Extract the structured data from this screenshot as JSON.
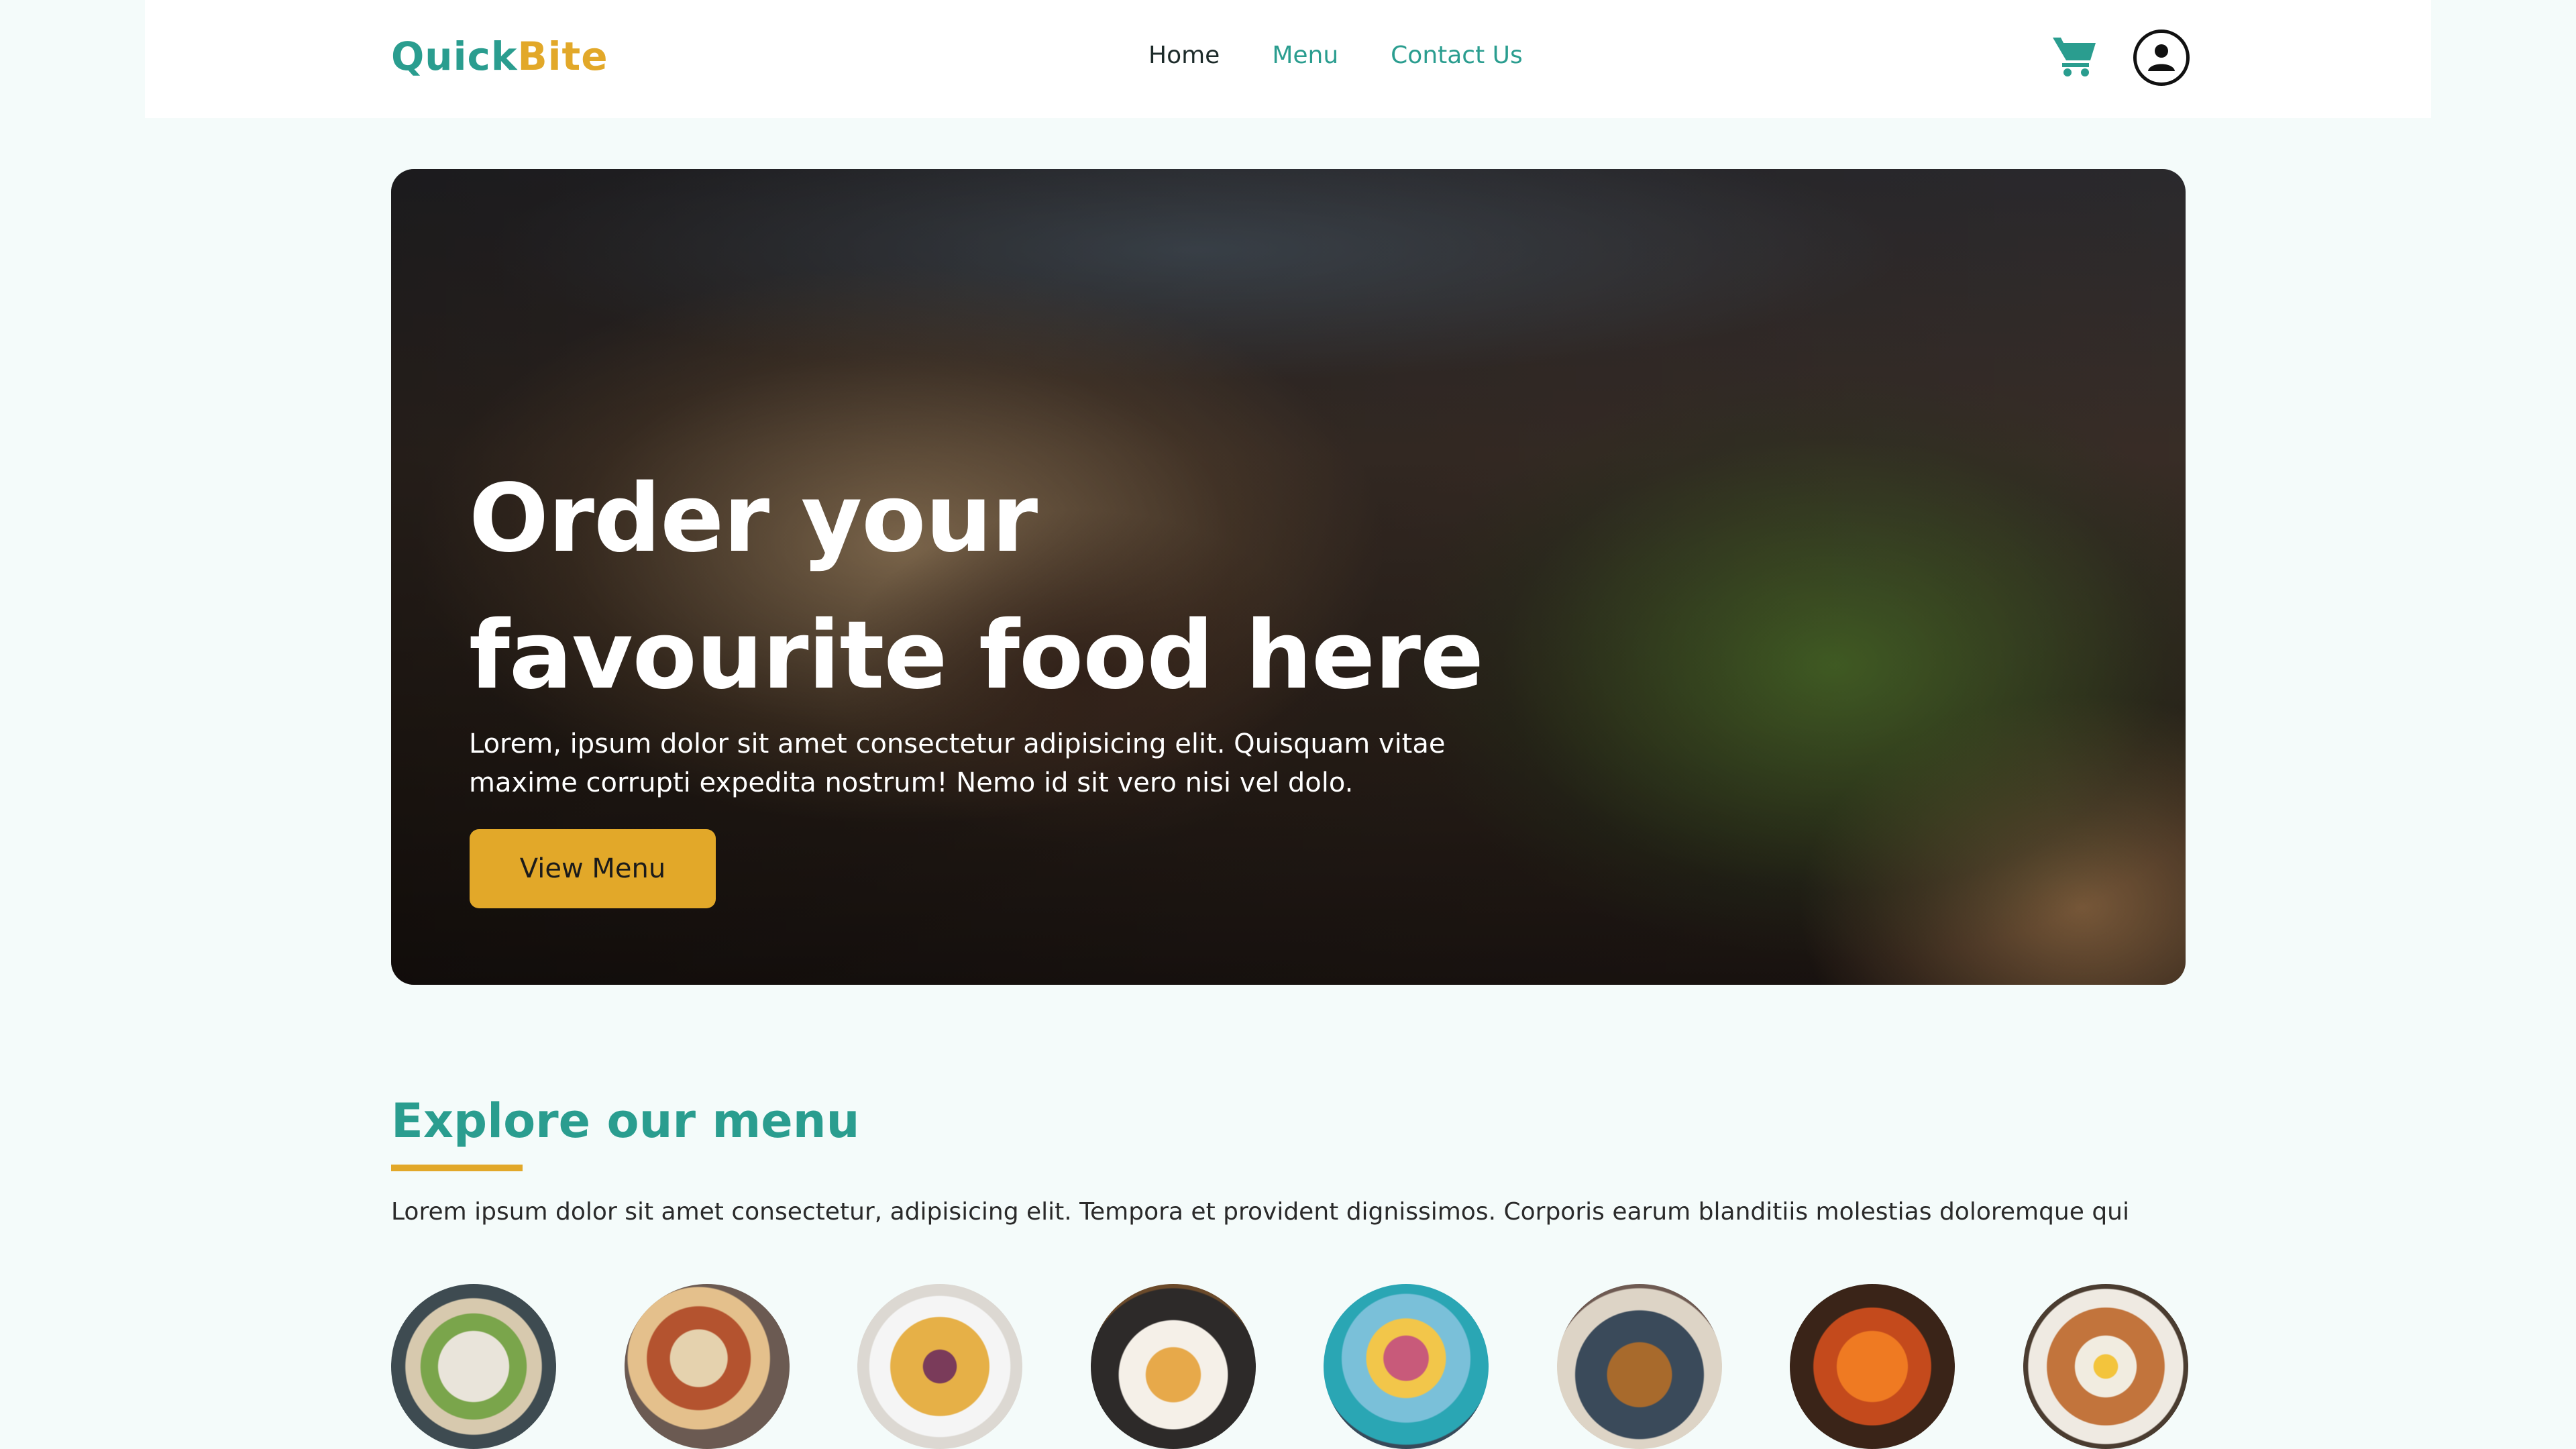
{
  "navbar": {
    "logo_part1": "Quick",
    "logo_part2": "Bite",
    "links": [
      {
        "label": "Home"
      },
      {
        "label": "Menu"
      },
      {
        "label": "Contact Us"
      }
    ],
    "icons": {
      "cart": "cart-icon",
      "profile": "user-circle-icon"
    }
  },
  "hero": {
    "title_line1": "Order your",
    "title_line2": "favourite food here",
    "text": "Lorem, ipsum dolor sit amet consectetur adipisicing elit. Quisquam vitae maxime corrupti expedita nostrum! Nemo id sit vero nisi vel dolo.",
    "button_label": "View Menu"
  },
  "explore": {
    "title": "Explore our menu",
    "text": "Lorem ipsum dolor sit amet consectetur, adipisicing elit. Tempora et provident dignissimos. Corporis earum blanditiis molestias doloremque qui"
  },
  "colors": {
    "accent": "#2a9d8f",
    "highlight": "#e2a829",
    "background": "#f4fbfa"
  }
}
